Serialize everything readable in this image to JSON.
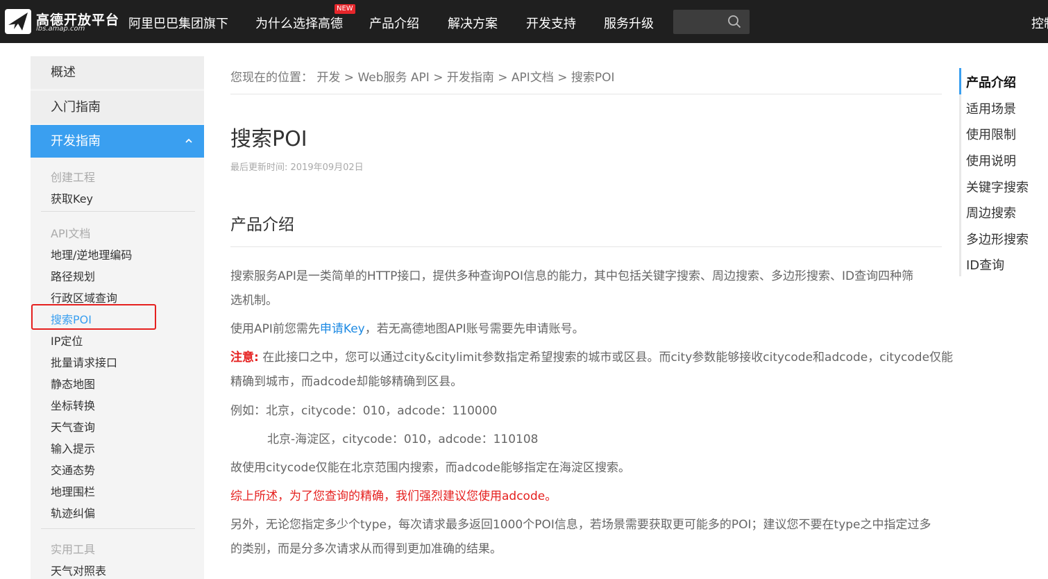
{
  "header": {
    "logo_cn": "高德开放平台",
    "logo_en": "lbs.amap.com",
    "nav": [
      "阿里巴巴集团旗下",
      "为什么选择高德",
      "产品介绍",
      "解决方案",
      "开发支持",
      "服务升级"
    ],
    "new_badge": "NEW",
    "search_placeholder": "",
    "console": "控制"
  },
  "sidebar": {
    "top": [
      "概述",
      "入门指南",
      "开发指南"
    ],
    "group1_label": "创建工程",
    "group1_items": [
      "获取Key"
    ],
    "group2_label": "API文档",
    "group2_items": [
      "地理/逆地理编码",
      "路径规划",
      "行政区域查询",
      "搜索POI",
      "IP定位",
      "批量请求接口",
      "静态地图",
      "坐标转换",
      "天气查询",
      "输入提示",
      "交通态势",
      "地理围栏",
      "轨迹纠偏"
    ],
    "group3_label": "实用工具",
    "group3_items": [
      "天气对照表"
    ]
  },
  "main": {
    "breadcrumb": "您现在的位置：  开发 > Web服务 API > 开发指南 > API文档 > 搜索POI",
    "title": "搜索POI",
    "updated": "最后更新时间: 2019年09月02日",
    "section_title": "产品介绍",
    "p1_line1": "搜索服务API是一类简单的HTTP接口，提供多种查询POI信息的能力，其中包括关键字搜索、周边搜索、多边形搜索、ID查询四种筛",
    "p1_line2": "选机制。",
    "p2_before": "使用API前您需先",
    "p2_link": "申请Key",
    "p2_after": "，若无高德地图API账号需要先申请账号。",
    "p3_label": "注意:",
    "p3_line1": " 在此接口之中，您可以通过city&citylimit参数指定希望搜索的城市或区县。而city参数能够接收citycode和adcode，citycode仅能",
    "p3_line2": "精确到城市，而adcode却能够精确到区县。",
    "p4": "例如：北京，citycode：010，adcode：110000",
    "p5": "北京-海淀区，citycode：010，adcode：110108",
    "p6": "故使用citycode仅能在北京范围内搜索，而adcode能够指定在海淀区搜索。",
    "p7": "综上所述，为了您查询的精确，我们强烈建议您使用adcode。",
    "p8_line1": "另外，无论您指定多少个type，每次请求最多返回1000个POI信息，若场景需要获取更可能多的POI；建议您不要在type之中指定过多",
    "p8_line2": "的类别，而是分多次请求从而得到更加准确的结果。"
  },
  "toc": [
    "产品介绍",
    "适用场景",
    "使用限制",
    "使用说明",
    "关键字搜索",
    "周边搜索",
    "多边形搜索",
    "ID查询"
  ],
  "colors": {
    "accent": "#3a9ff0",
    "warning": "#e5201f",
    "topbar": "#1f1f1f"
  }
}
